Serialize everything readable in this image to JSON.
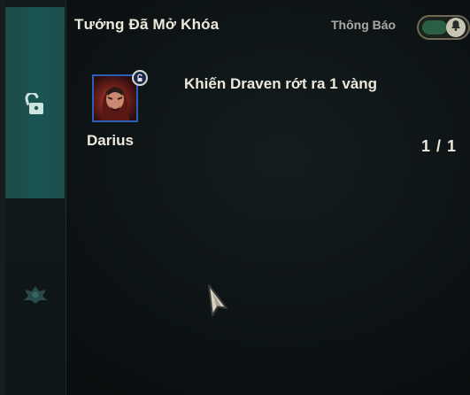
{
  "header": {
    "title": "Tướng Đã Mở Khóa",
    "notify_label": "Thông Báo",
    "notify_enabled": true
  },
  "sidebar": {
    "items": [
      {
        "icon": "unlock-icon",
        "active": true
      },
      {
        "icon": "crest-icon",
        "active": false
      }
    ]
  },
  "missions": [
    {
      "champion": "Darius",
      "description": "Khiến Draven rớt ra 1 vàng",
      "progress": "1 / 1"
    }
  ],
  "colors": {
    "accent_teal": "#1a5553",
    "portrait_border": "#2e5db6",
    "text": "#ece8dc"
  }
}
